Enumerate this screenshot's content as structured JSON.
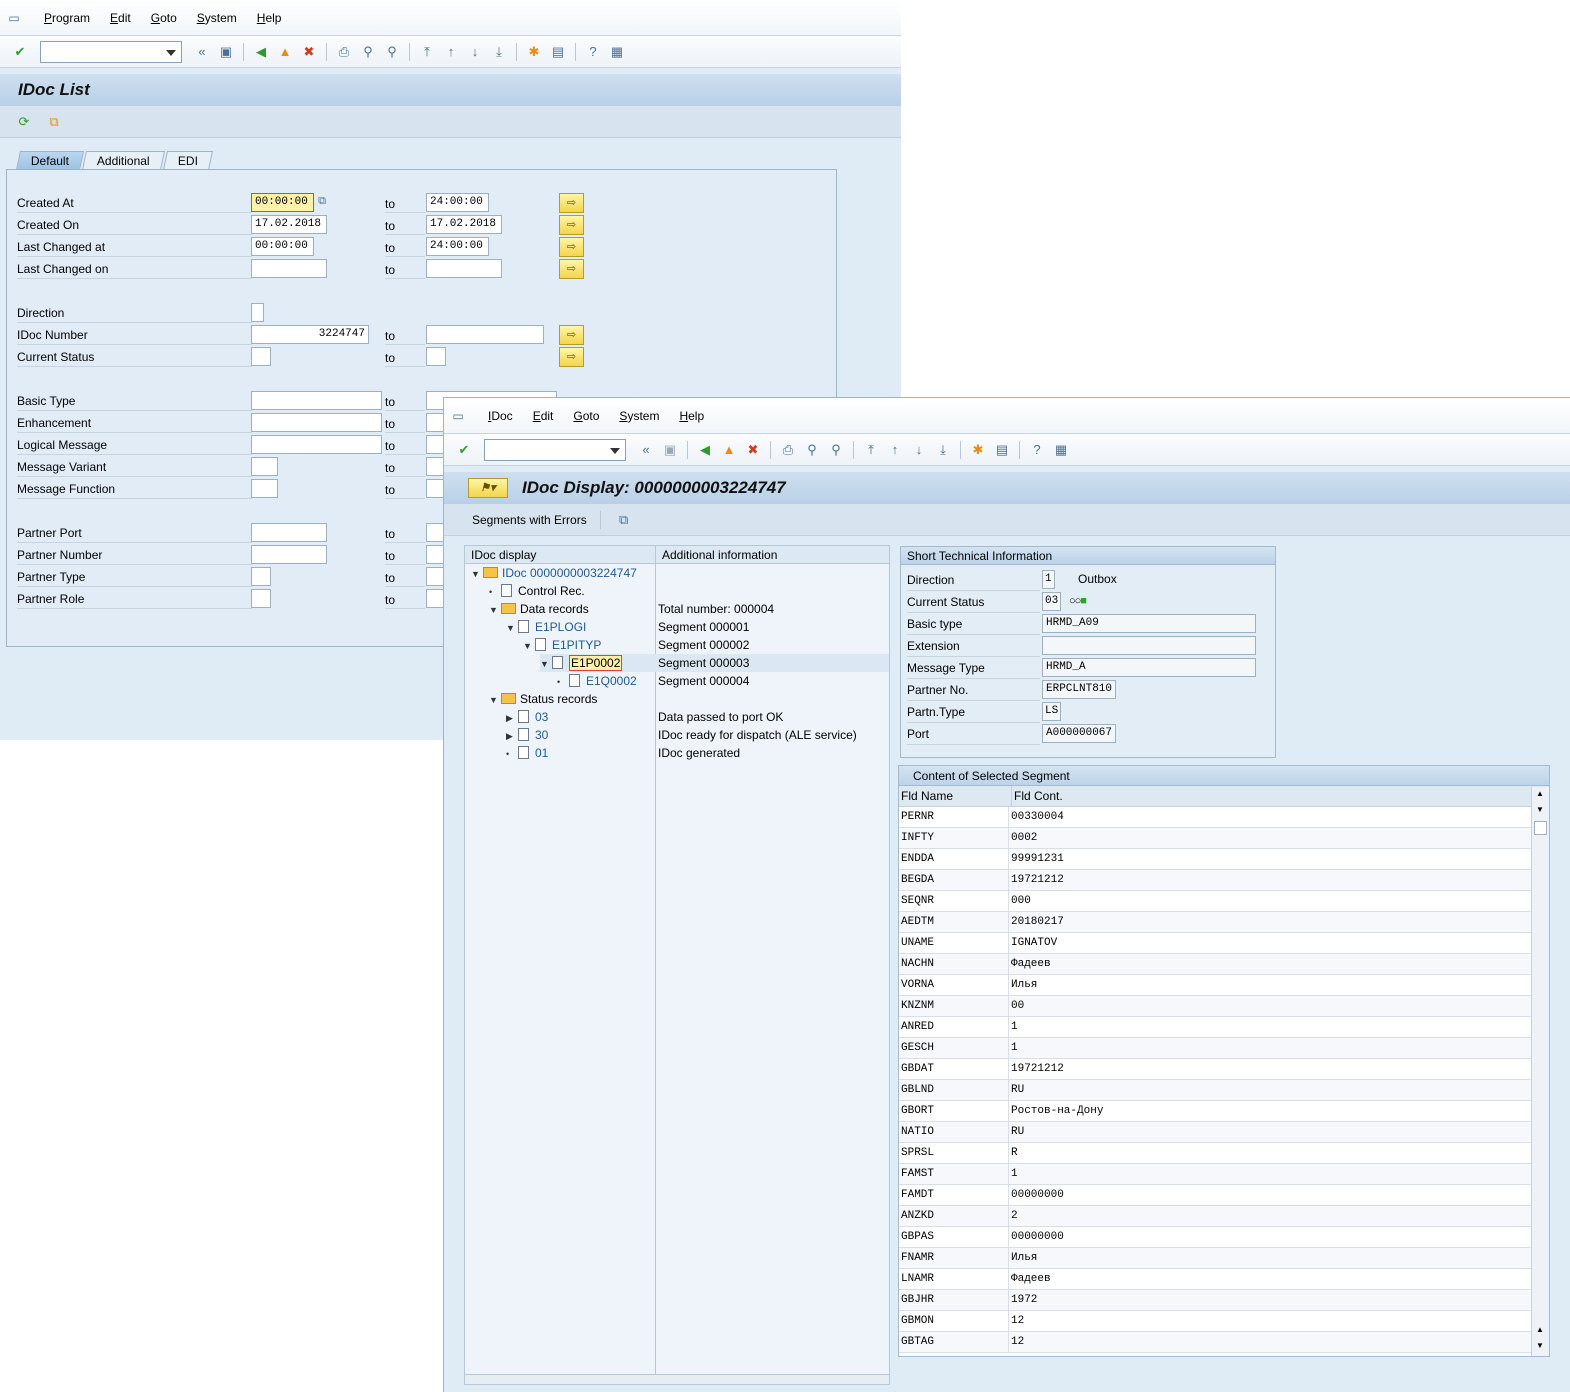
{
  "win1": {
    "menu": [
      "Program",
      "Edit",
      "Goto",
      "System",
      "Help"
    ],
    "title": "IDoc List",
    "tabs": [
      "Default",
      "Additional",
      "EDI"
    ],
    "fields": [
      {
        "label": "Created At",
        "from": "00:00:00",
        "to": "24:00:00"
      },
      {
        "label": "Created On",
        "from": "17.02.2018",
        "to": "17.02.2018"
      },
      {
        "label": "Last Changed at",
        "from": "00:00:00",
        "to": "24:00:00"
      },
      {
        "label": "Last Changed on",
        "from": "",
        "to": ""
      },
      {
        "label": "Direction",
        "from": "",
        "to": ""
      },
      {
        "label": "IDoc Number",
        "from": "3224747",
        "to": ""
      },
      {
        "label": "Current Status",
        "from": "",
        "to": ""
      },
      {
        "label": "Basic Type",
        "from": "",
        "to": ""
      },
      {
        "label": "Enhancement",
        "from": "",
        "to": ""
      },
      {
        "label": "Logical Message",
        "from": "",
        "to": ""
      },
      {
        "label": "Message Variant",
        "from": "",
        "to": ""
      },
      {
        "label": "Message Function",
        "from": "",
        "to": ""
      },
      {
        "label": "Partner Port",
        "from": "",
        "to": ""
      },
      {
        "label": "Partner Number",
        "from": "",
        "to": ""
      },
      {
        "label": "Partner Type",
        "from": "",
        "to": ""
      },
      {
        "label": "Partner Role",
        "from": "",
        "to": ""
      }
    ],
    "to_label": "to"
  },
  "win2": {
    "menu": [
      "IDoc",
      "Edit",
      "Goto",
      "System",
      "Help"
    ],
    "title": "IDoc Display: 0000000003224747",
    "app_button": "Segments with Errors",
    "tree_headers": [
      "IDoc display",
      "Additional information"
    ],
    "tree": [
      {
        "text": "IDoc 0000000003224747",
        "info": ""
      },
      {
        "text": "Control Rec.",
        "info": ""
      },
      {
        "text": "Data records",
        "info": "Total number: 000004"
      },
      {
        "text": "E1PLOGI",
        "info": "Segment 000001"
      },
      {
        "text": "E1PITYP",
        "info": "Segment 000002"
      },
      {
        "text": "E1P0002",
        "info": "Segment 000003"
      },
      {
        "text": "E1Q0002",
        "info": "Segment 000004"
      },
      {
        "text": "Status records",
        "info": ""
      },
      {
        "text": "03",
        "info": "Data passed to port OK"
      },
      {
        "text": "30",
        "info": "IDoc ready for dispatch (ALE service)"
      },
      {
        "text": "01",
        "info": "IDoc generated"
      }
    ],
    "short_info": {
      "title": "Short Technical Information",
      "rows": [
        {
          "label": "Direction",
          "value": "1",
          "extra": "Outbox"
        },
        {
          "label": "Current Status",
          "value": "03",
          "extra": ""
        },
        {
          "label": "Basic type",
          "value": "HRMD_A09",
          "extra": ""
        },
        {
          "label": "Extension",
          "value": "",
          "extra": ""
        },
        {
          "label": "Message Type",
          "value": "HRMD_A",
          "extra": ""
        },
        {
          "label": "Partner No.",
          "value": "ERPCLNT810",
          "extra": ""
        },
        {
          "label": "Partn.Type",
          "value": "LS",
          "extra": ""
        },
        {
          "label": "Port",
          "value": "A000000067",
          "extra": ""
        }
      ]
    },
    "segment": {
      "title": "Content of Selected Segment",
      "headers": [
        "Fld Name",
        "Fld Cont."
      ],
      "rows": [
        [
          "PERNR",
          "00330004"
        ],
        [
          "INFTY",
          "0002"
        ],
        [
          "ENDDA",
          "99991231"
        ],
        [
          "BEGDA",
          "19721212"
        ],
        [
          "SEQNR",
          "000"
        ],
        [
          "AEDTM",
          "20180217"
        ],
        [
          "UNAME",
          "IGNATOV"
        ],
        [
          "NACHN",
          "Фадеев"
        ],
        [
          "VORNA",
          "Илья"
        ],
        [
          "KNZNM",
          "00"
        ],
        [
          "ANRED",
          "1"
        ],
        [
          "GESCH",
          "1"
        ],
        [
          "GBDAT",
          "19721212"
        ],
        [
          "GBLND",
          "RU"
        ],
        [
          "GBORT",
          "Ростов-на-Дону"
        ],
        [
          "NATIO",
          "RU"
        ],
        [
          "SPRSL",
          "R"
        ],
        [
          "FAMST",
          "1"
        ],
        [
          "FAMDT",
          "00000000"
        ],
        [
          "ANZKD",
          "2"
        ],
        [
          "GBPAS",
          "00000000"
        ],
        [
          "FNAMR",
          "Илья"
        ],
        [
          "LNAMR",
          "Фадеев"
        ],
        [
          "GBJHR",
          "1972"
        ],
        [
          "GBMON",
          "12"
        ],
        [
          "GBTAG",
          "12"
        ]
      ]
    }
  }
}
